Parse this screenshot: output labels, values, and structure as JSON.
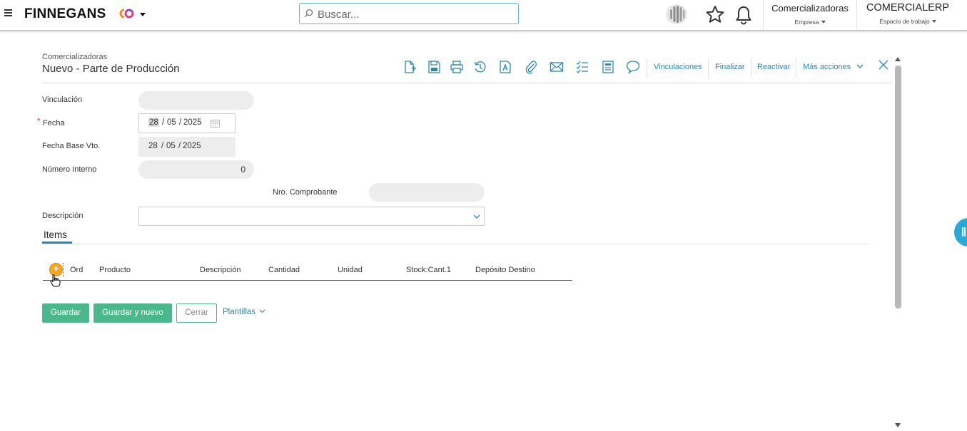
{
  "header": {
    "logo_text": "FINNEGANS",
    "search_placeholder": "Buscar...",
    "company_context": {
      "name": "Comercializadoras",
      "label": "Empresa"
    },
    "workspace_context": {
      "name": "COMERCIALERP",
      "label": "Espacio de trabajo"
    }
  },
  "form": {
    "company": "Comercializadoras",
    "title": "Nuevo - Parte de Producción",
    "toolbar_links": {
      "vinculaciones": "Vinculaciones",
      "finalizar": "Finalizar",
      "reactivar": "Reactivar",
      "mas_acciones": "Más acciones"
    },
    "fields": {
      "vinculacion": {
        "label": "Vinculación",
        "value": ""
      },
      "fecha": {
        "label": "Fecha",
        "required_mark": "*",
        "day": "28",
        "month": "05",
        "year": "2025"
      },
      "fecha_base_vto": {
        "label": "Fecha Base Vto.",
        "day": "28",
        "month": "05",
        "year": "2025"
      },
      "numero_interno": {
        "label": "Número Interno",
        "value": "0"
      },
      "nro_comprobante": {
        "label": "Nro. Comprobante",
        "value": ""
      },
      "descripcion": {
        "label": "Descripción",
        "value": ""
      }
    },
    "date_separator": "/",
    "tabs": {
      "items": "Items"
    },
    "items_columns": [
      "Ord",
      "Producto",
      "Descripción",
      "Cantidad",
      "Unidad",
      "Stock:Cant.1",
      "Depósito Destino"
    ],
    "add_symbol": "+",
    "buttons": {
      "guardar": "Guardar",
      "guardar_y_nuevo": "Guardar y nuevo",
      "cerrar": "Cerrar",
      "plantillas": "Plantillas"
    }
  },
  "colors": {
    "accent_blue": "#2a86b8",
    "button_green": "#4bb88c",
    "add_orange": "#f5a623",
    "side_handle": "#29a9d8"
  }
}
